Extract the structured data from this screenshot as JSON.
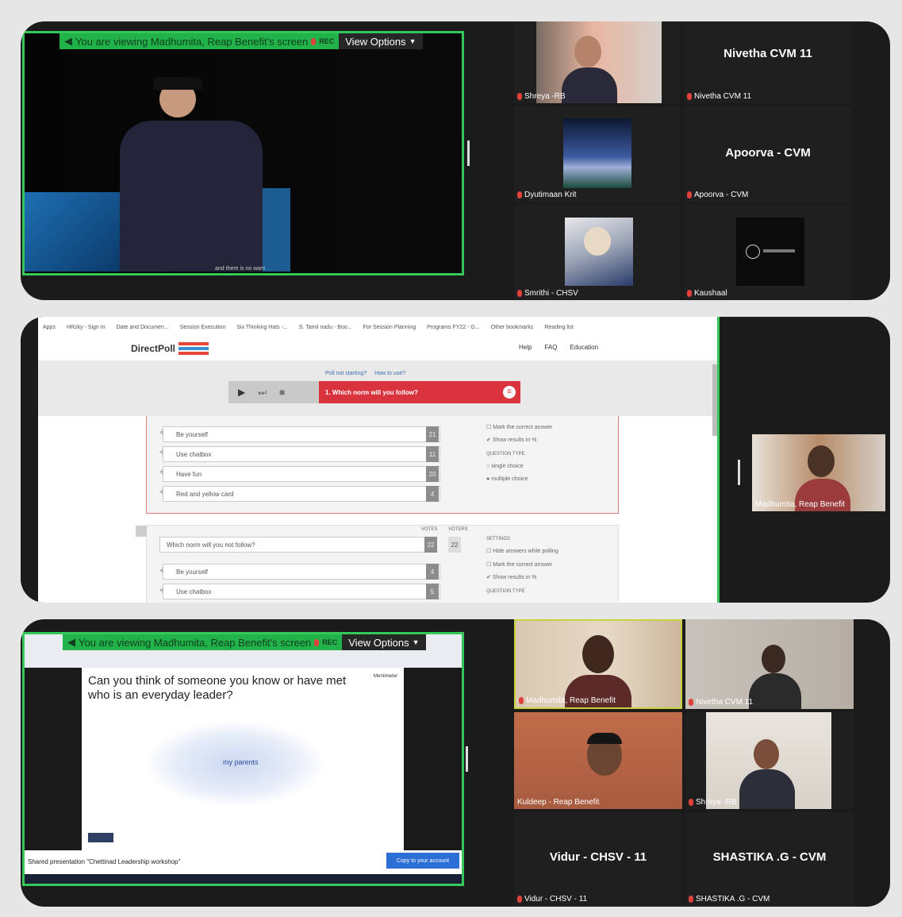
{
  "meeting": {
    "banner_text": "You are viewing Madhumita, Reap Benefit's screen",
    "rec_label": "REC",
    "view_options_label": "View Options"
  },
  "panel1": {
    "caption": "and there is no warn",
    "participants": [
      {
        "name": "Shreya -RB",
        "video": true
      },
      {
        "name": "Nivetha CVM 11",
        "big_name": "Nivetha CVM 11",
        "video": false
      },
      {
        "name": "Dyutimaan Krit",
        "video": true
      },
      {
        "name": "Apoorva - CVM",
        "big_name": "Apoorva - CVM",
        "video": false
      },
      {
        "name": "Smrithi - CHSV",
        "video": true
      },
      {
        "name": "Kaushaal",
        "video": true
      }
    ]
  },
  "panel2": {
    "bookmarks": [
      "Apps",
      "HRzky - Sign In",
      "Date and Documen...",
      "Session Execution",
      "Six Thinking Hats -...",
      "S. Tamil nadu - Boo...",
      "For Session Planning",
      "Programs FY22 - G...",
      "Other bookmarks",
      "Reading list"
    ],
    "logo": "DirectPoll",
    "nav": [
      "Help",
      "FAQ",
      "Education"
    ],
    "links": [
      "Poll not starting?",
      "How to use?"
    ],
    "question_title": "1. Which norm will you follow?",
    "options": [
      {
        "label": "Be yourself",
        "count": "21"
      },
      {
        "label": "Use chatbox",
        "count": "11"
      },
      {
        "label": "Have fun",
        "count": "20"
      },
      {
        "label": "Red and yellow card",
        "count": "4"
      }
    ],
    "settings": [
      "Mark the correct answer",
      "Show results in %"
    ],
    "question_type_label": "QUESTION TYPE",
    "types": [
      "single choice",
      "multiple choice"
    ],
    "q2_headers": [
      "VOTES",
      "VOTERS"
    ],
    "q2_text": "Which norm will you not follow?",
    "q2_votes": "22",
    "q2_voters": "22",
    "q2_options": [
      {
        "label": "Be yourself",
        "count": "4"
      },
      {
        "label": "Use chatbox",
        "count": "5"
      }
    ],
    "settings2_label": "SETTINGS",
    "settings2": [
      "Hide answers while polling",
      "Mark the correct answer",
      "Show results in %"
    ],
    "question_type_label2": "QUESTION TYPE",
    "presenter_name": "Madhumita, Reap Benefit"
  },
  "panel3": {
    "slide_question": "Can you think of someone you know or have met who is an everyday leader?",
    "slide_brand": "Mentimeter",
    "cloud_word": "my parents",
    "shared_text": "Shared presentation \"Chettinad Leadership workshop\"",
    "copy_button": "Copy to your account",
    "participants": [
      {
        "name": "Madhumita, Reap Benefit",
        "video": true
      },
      {
        "name": "Nivetha CVM 11",
        "video": true
      },
      {
        "name": "Kuldeep - Reap Benefit",
        "video": true
      },
      {
        "name": "Shreya -RB",
        "video": true
      },
      {
        "name": "Vidur - CHSV - 11",
        "big_name": "Vidur - CHSV - 11",
        "video": false
      },
      {
        "name": "SHASTIKA .G - CVM",
        "big_name": "SHASTIKA .G - CVM",
        "video": false
      }
    ]
  },
  "colors": {
    "accent_green": "#34c85a",
    "poll_red": "#d9343d",
    "zoom_bg": "#1b1b1b"
  }
}
